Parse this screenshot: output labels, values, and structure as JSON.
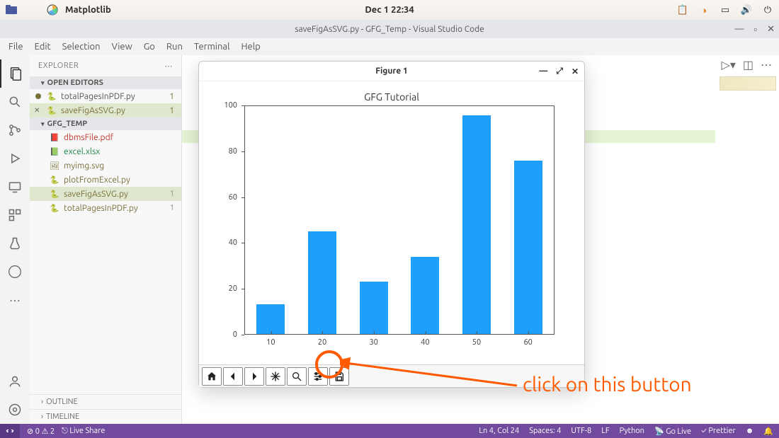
{
  "os_panel": {
    "app_name": "Matplotlib",
    "clock": "Dec 1  22:34"
  },
  "vscode": {
    "title": "saveFigAsSVG.py - GFG_Temp - Visual Studio Code",
    "menu": [
      "File",
      "Edit",
      "Selection",
      "View",
      "Go",
      "Run",
      "Terminal",
      "Help"
    ]
  },
  "explorer": {
    "header": "EXPLORER",
    "open_editors_label": "OPEN EDITORS",
    "open_editors": [
      {
        "name": "totalPagesInPDF.py",
        "dirty": true,
        "badge": "1"
      },
      {
        "name": "saveFigAsSVG.py",
        "dirty": false,
        "close": true,
        "active": true,
        "badge": "1"
      }
    ],
    "folder_label": "GFG_TEMP",
    "files": [
      {
        "name": "dbmsFile.pdf",
        "icon": "pdf",
        "color": "#c0392b"
      },
      {
        "name": "excel.xlsx",
        "icon": "excel",
        "color": "#1e8449"
      },
      {
        "name": "myimg.svg",
        "icon": "svg",
        "color": "#7a6f3a"
      },
      {
        "name": "plotFromExcel.py",
        "icon": "py",
        "color": "#7a6f3a"
      },
      {
        "name": "saveFigAsSVG.py",
        "icon": "py",
        "color": "#7a6f3a",
        "sel": true,
        "badge": "1"
      },
      {
        "name": "totalPagesInPDF.py",
        "icon": "py",
        "color": "#7a6f3a",
        "badge": "1"
      }
    ],
    "outline_label": "OUTLINE",
    "timeline_label": "TIMELINE"
  },
  "figure": {
    "title": "Figure 1",
    "toolbar_names": [
      "home",
      "back",
      "forward",
      "pan",
      "zoom",
      "configure",
      "save"
    ]
  },
  "chart_data": {
    "type": "bar",
    "title": "GFG Tutorial",
    "categories": [
      "10",
      "20",
      "30",
      "40",
      "50",
      "60"
    ],
    "values": [
      13,
      45,
      23,
      34,
      96,
      76
    ],
    "ylim": [
      0,
      100
    ],
    "yticks": [
      0,
      20,
      40,
      60,
      80,
      100
    ],
    "xlabel": "",
    "ylabel": ""
  },
  "annotation": {
    "text": "click on this button"
  },
  "statusbar": {
    "errors": "0",
    "warnings": "2",
    "liveshare": "Live Share",
    "cursor": "Ln 4, Col 24",
    "spaces": "Spaces: 4",
    "encoding": "UTF-8",
    "eol": "LF",
    "lang": "Python",
    "golive": "Go Live",
    "prettier": "Prettier"
  }
}
